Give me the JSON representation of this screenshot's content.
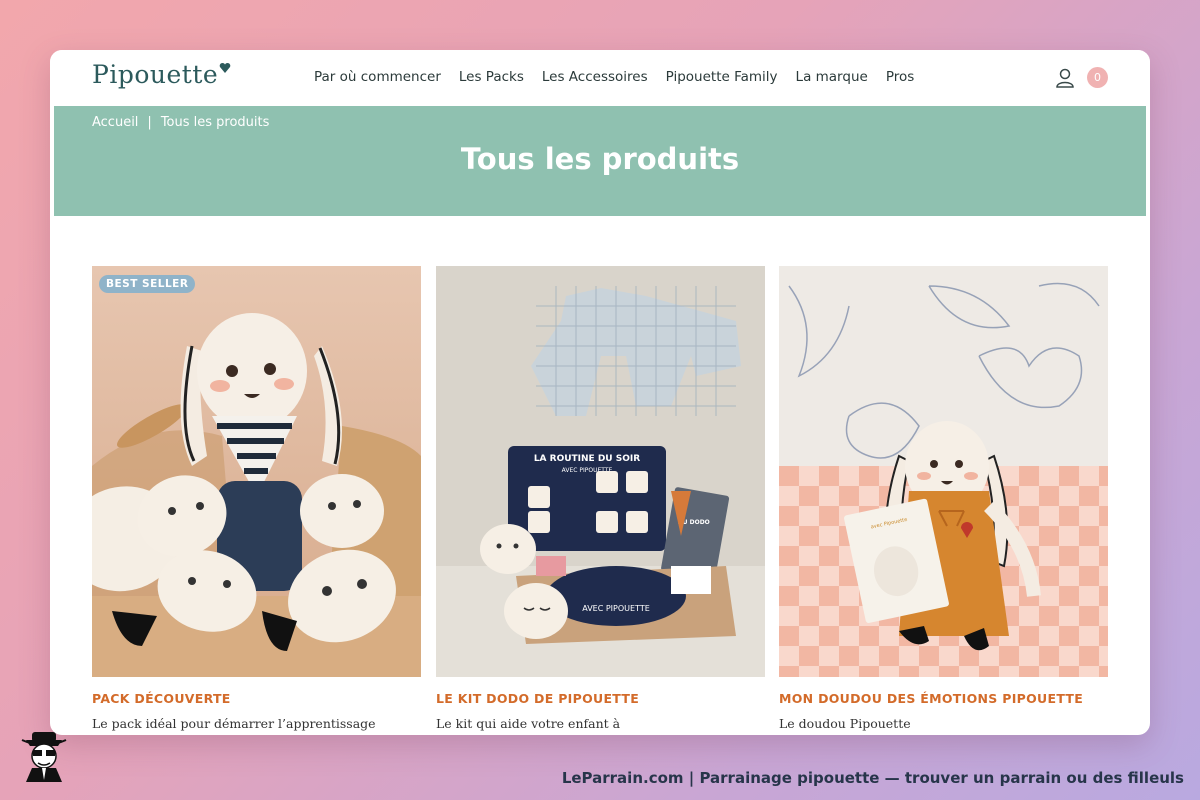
{
  "header": {
    "logo": "Pipouette",
    "nav": [
      "Par où commencer",
      "Les Packs",
      "Les Accessoires",
      "Pipouette Family",
      "La marque",
      "Pros"
    ],
    "cart_count": "0"
  },
  "breadcrumb": {
    "home": "Accueil",
    "separator": "|",
    "current": "Tous les produits"
  },
  "hero": {
    "title": "Tous les produits"
  },
  "products": [
    {
      "badge": "BEST SELLER",
      "name": "PACK DÉCOUVERTE",
      "desc": "Le pack idéal pour démarrer l’apprentissage"
    },
    {
      "badge": "",
      "name": "LE KIT DODO DE PIPOUETTE",
      "desc": "Le kit qui aide votre enfant à"
    },
    {
      "badge": "",
      "name": "MON DOUDOU DES ÉMOTIONS PIPOUETTE",
      "desc": "Le doudou Pipouette"
    }
  ],
  "product_image_text": {
    "box_title": "LA ROUTINE DU SOIR",
    "box_subtitle": "AVEC PIPOUETTE",
    "book_title": "AU DODO",
    "tray_text": "AVEC PIPOUETTE",
    "book2_title": "avec Pipouette"
  },
  "footer": {
    "text": "LeParrain.com | Parrainage pipouette — trouver un parrain ou des filleuls"
  },
  "colors": {
    "hero": "#8fc1b0",
    "accent": "#d36b2a",
    "badge": "#8fb3c9",
    "cart": "#f0b2b2"
  }
}
